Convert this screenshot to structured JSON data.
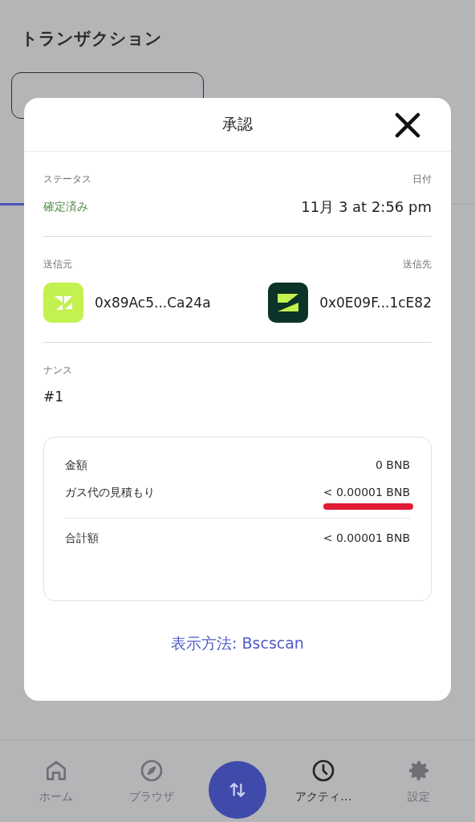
{
  "page": {
    "title": "トランザクション"
  },
  "modal": {
    "title": "承認",
    "status": {
      "label": "ステータス",
      "value": "確定済み"
    },
    "date": {
      "label": "日付",
      "value": "11月 3 at 2:56 pm"
    },
    "from": {
      "label": "送信元",
      "address": "0x89Ac5...Ca24a"
    },
    "to": {
      "label": "送信先",
      "address": "0x0E09F...1cE82"
    },
    "nonce": {
      "label": "ナンス",
      "value": "#1"
    },
    "summary": [
      {
        "label": "金額",
        "value": "0 BNB",
        "underlined": false,
        "total": false
      },
      {
        "label": "ガス代の見積もり",
        "value": "< 0.00001 BNB",
        "underlined": true,
        "total": false
      },
      {
        "label": "合計額",
        "value": "< 0.00001 BNB",
        "underlined": false,
        "total": true
      }
    ],
    "link": "表示方法: Bscscan"
  },
  "nav": [
    {
      "kind": "home",
      "label": "ホーム",
      "selected": false
    },
    {
      "kind": "browser",
      "label": "ブラウザ",
      "selected": false
    },
    {
      "kind": "swap"
    },
    {
      "kind": "activity",
      "label": "アクティ…",
      "selected": true
    },
    {
      "kind": "settings",
      "label": "設定",
      "selected": false
    }
  ]
}
